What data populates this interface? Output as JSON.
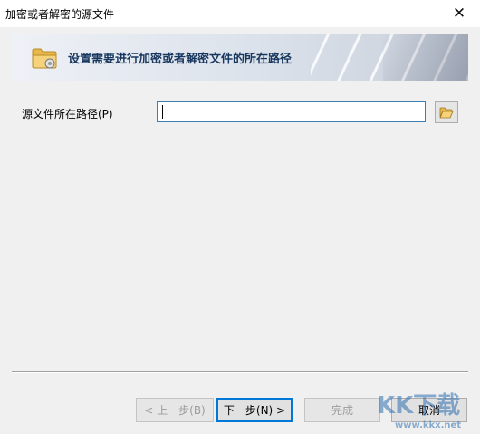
{
  "window": {
    "title": "加密或者解密的源文件",
    "close_glyph": "✕"
  },
  "banner": {
    "text": "设置需要进行加密或者解密文件的所在路径",
    "icon": "folder-gear-icon"
  },
  "form": {
    "label": "源文件所在路径(P)",
    "path_value": "",
    "browse_icon": "folder-open-icon"
  },
  "buttons": {
    "back": "< 上一步(B)",
    "next": "下一步(N) >",
    "finish": "完成",
    "cancel": "取消"
  },
  "watermark": {
    "brand": "KK下载",
    "url": "www.kkx.net"
  },
  "colors": {
    "banner_text": "#17375e",
    "input_border": "#3c7fb1",
    "default_button_border": "#0078d7",
    "folder": "#f4c85a"
  }
}
